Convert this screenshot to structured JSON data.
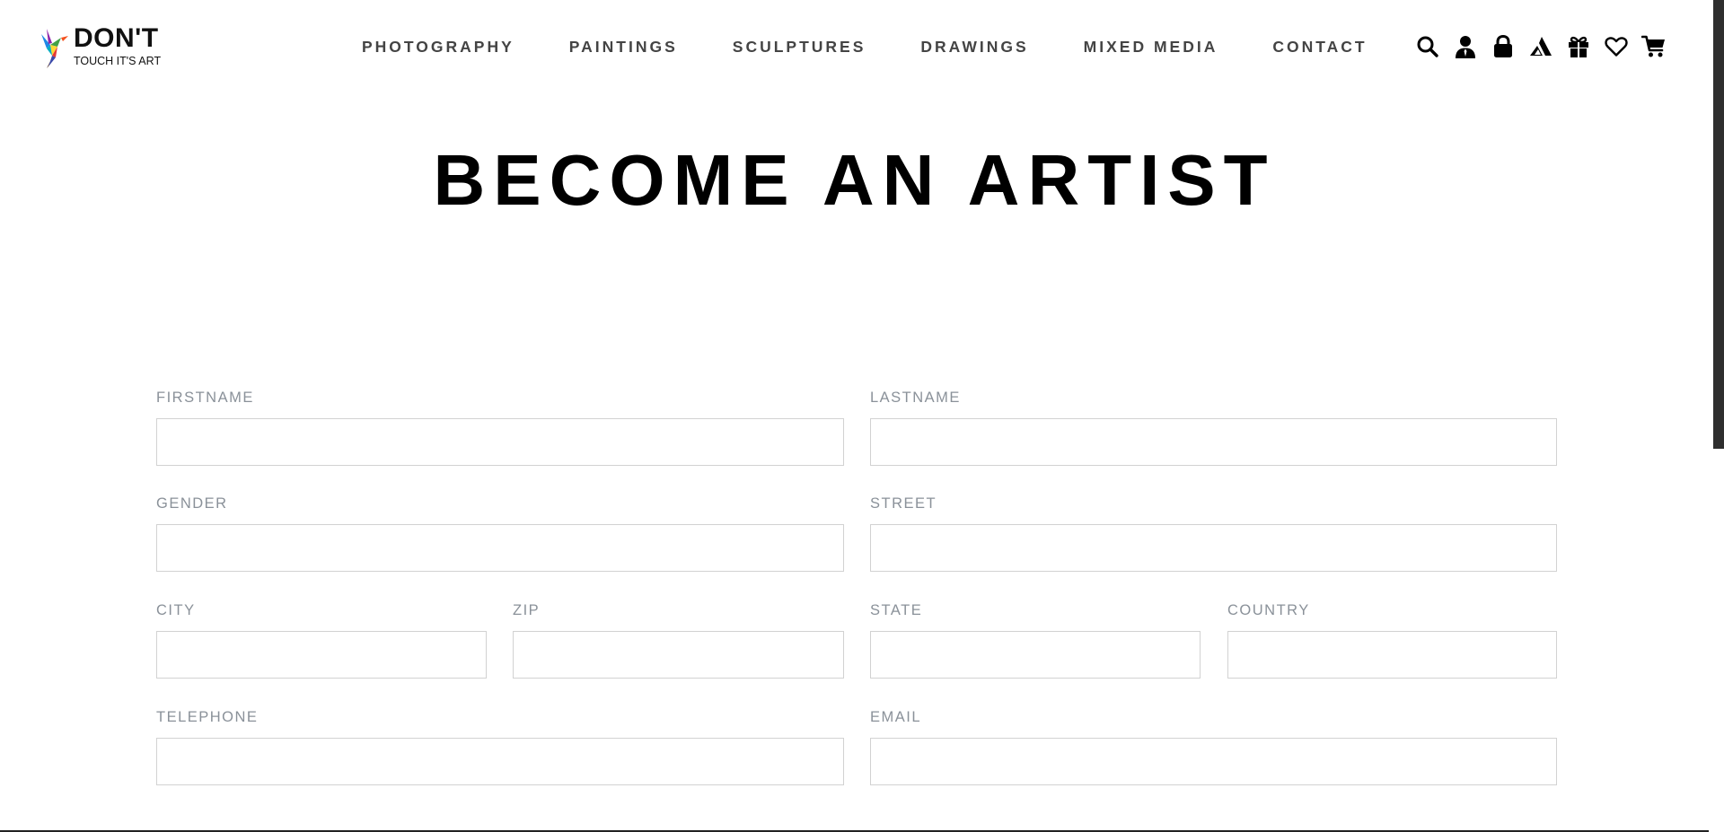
{
  "brand": {
    "title": "DON'T",
    "subtitle": "TOUCH IT'S ART"
  },
  "nav": {
    "items": [
      {
        "label": "PHOTOGRAPHY"
      },
      {
        "label": "PAINTINGS"
      },
      {
        "label": "SCULPTURES"
      },
      {
        "label": "DRAWINGS"
      },
      {
        "label": "MIXED MEDIA"
      },
      {
        "label": "CONTACT"
      }
    ]
  },
  "header_icons": [
    "search-icon",
    "user-icon",
    "lock-icon",
    "artist-icon",
    "gift-icon",
    "heart-icon",
    "cart-icon"
  ],
  "page": {
    "title": "BECOME AN ARTIST"
  },
  "form": {
    "firstname": {
      "label": "FIRSTNAME",
      "value": ""
    },
    "lastname": {
      "label": "LASTNAME",
      "value": ""
    },
    "gender": {
      "label": "GENDER",
      "value": ""
    },
    "street": {
      "label": "STREET",
      "value": ""
    },
    "city": {
      "label": "CITY",
      "value": ""
    },
    "zip": {
      "label": "ZIP",
      "value": ""
    },
    "state": {
      "label": "STATE",
      "value": ""
    },
    "country": {
      "label": "COUNTRY",
      "value": ""
    },
    "telephone": {
      "label": "TELEPHONE",
      "value": ""
    },
    "email": {
      "label": "EMAIL",
      "value": ""
    }
  },
  "colors": {
    "text": "#000000",
    "nav": "#444444",
    "label": "#8a9199",
    "input_border": "#d2d2d2",
    "scrollbar_thumb": "#2e2e2e"
  }
}
